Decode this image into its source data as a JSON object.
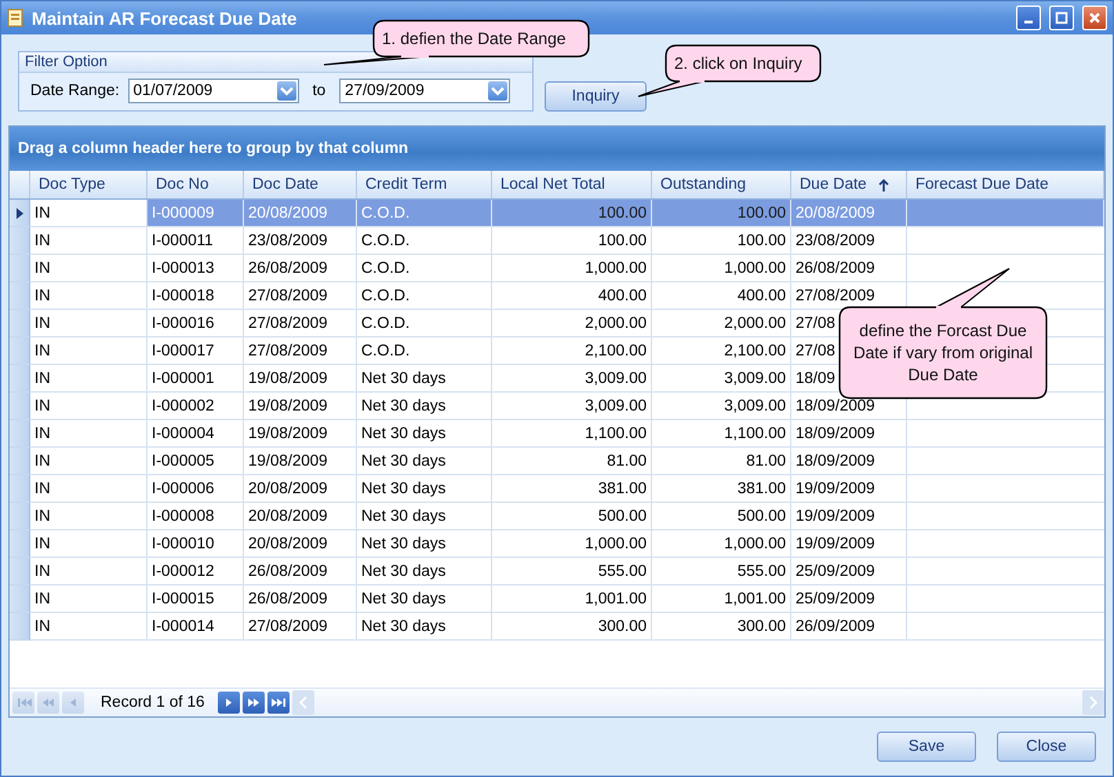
{
  "window": {
    "title": "Maintain AR Forecast Due Date"
  },
  "filter": {
    "group_title": "Filter Option",
    "label": "Date Range:",
    "from": "01/07/2009",
    "to_label": "to",
    "to": "27/09/2009"
  },
  "inquiry_button": "Inquiry",
  "group_panel": "Drag a column header here to group by that column",
  "table": {
    "columns": [
      {
        "label": "Doc Type",
        "kind": "text",
        "sorted": false
      },
      {
        "label": "Doc No",
        "kind": "text",
        "sorted": false
      },
      {
        "label": "Doc Date",
        "kind": "text",
        "sorted": false
      },
      {
        "label": "Credit Term",
        "kind": "text",
        "sorted": false
      },
      {
        "label": "Local Net Total",
        "kind": "number",
        "sorted": false
      },
      {
        "label": "Outstanding",
        "kind": "number",
        "sorted": false
      },
      {
        "label": "Due Date",
        "kind": "text",
        "sorted": true
      },
      {
        "label": "Forecast Due Date",
        "kind": "text",
        "sorted": false
      }
    ],
    "rows": [
      {
        "selected": true,
        "cells": [
          "IN",
          "I-000009",
          "20/08/2009",
          "C.O.D.",
          "100.00",
          "100.00",
          "20/08/2009"
        ]
      },
      {
        "selected": false,
        "cells": [
          "IN",
          "I-000011",
          "23/08/2009",
          "C.O.D.",
          "100.00",
          "100.00",
          "23/08/2009"
        ]
      },
      {
        "selected": false,
        "cells": [
          "IN",
          "I-000013",
          "26/08/2009",
          "C.O.D.",
          "1,000.00",
          "1,000.00",
          "26/08/2009"
        ]
      },
      {
        "selected": false,
        "cells": [
          "IN",
          "I-000018",
          "27/08/2009",
          "C.O.D.",
          "400.00",
          "400.00",
          "27/08/2009"
        ]
      },
      {
        "selected": false,
        "cells": [
          "IN",
          "I-000016",
          "27/08/2009",
          "C.O.D.",
          "2,000.00",
          "2,000.00",
          "27/08"
        ]
      },
      {
        "selected": false,
        "cells": [
          "IN",
          "I-000017",
          "27/08/2009",
          "C.O.D.",
          "2,100.00",
          "2,100.00",
          "27/08"
        ]
      },
      {
        "selected": false,
        "cells": [
          "IN",
          "I-000001",
          "19/08/2009",
          "Net 30 days",
          "3,009.00",
          "3,009.00",
          "18/09"
        ]
      },
      {
        "selected": false,
        "cells": [
          "IN",
          "I-000002",
          "19/08/2009",
          "Net 30 days",
          "3,009.00",
          "3,009.00",
          "18/09/2009"
        ]
      },
      {
        "selected": false,
        "cells": [
          "IN",
          "I-000004",
          "19/08/2009",
          "Net 30 days",
          "1,100.00",
          "1,100.00",
          "18/09/2009"
        ]
      },
      {
        "selected": false,
        "cells": [
          "IN",
          "I-000005",
          "19/08/2009",
          "Net 30 days",
          "81.00",
          "81.00",
          "18/09/2009"
        ]
      },
      {
        "selected": false,
        "cells": [
          "IN",
          "I-000006",
          "20/08/2009",
          "Net 30 days",
          "381.00",
          "381.00",
          "19/09/2009"
        ]
      },
      {
        "selected": false,
        "cells": [
          "IN",
          "I-000008",
          "20/08/2009",
          "Net 30 days",
          "500.00",
          "500.00",
          "19/09/2009"
        ]
      },
      {
        "selected": false,
        "cells": [
          "IN",
          "I-000010",
          "20/08/2009",
          "Net 30 days",
          "1,000.00",
          "1,000.00",
          "19/09/2009"
        ]
      },
      {
        "selected": false,
        "cells": [
          "IN",
          "I-000012",
          "26/08/2009",
          "Net 30 days",
          "555.00",
          "555.00",
          "25/09/2009"
        ]
      },
      {
        "selected": false,
        "cells": [
          "IN",
          "I-000015",
          "26/08/2009",
          "Net 30 days",
          "1,001.00",
          "1,001.00",
          "25/09/2009"
        ]
      },
      {
        "selected": false,
        "cells": [
          "IN",
          "I-000014",
          "27/08/2009",
          "Net 30 days",
          "300.00",
          "300.00",
          "26/09/2009"
        ]
      }
    ]
  },
  "navigator": {
    "buttons_before": [
      {
        "kind": "first",
        "disabled": true
      },
      {
        "kind": "prev-page",
        "disabled": true
      },
      {
        "kind": "prev",
        "disabled": true
      }
    ],
    "record": "Record 1 of 16",
    "buttons_after": [
      {
        "kind": "next",
        "disabled": false
      },
      {
        "kind": "next-page",
        "disabled": false
      },
      {
        "kind": "last",
        "disabled": false
      }
    ]
  },
  "buttons": [
    "Save",
    "Close"
  ],
  "callouts": [
    {
      "text": "1. defien the Date Range"
    },
    {
      "text": "2. click on Inquiry"
    },
    {
      "text": "define the Forcast Due Date if vary from original Due Date"
    }
  ]
}
